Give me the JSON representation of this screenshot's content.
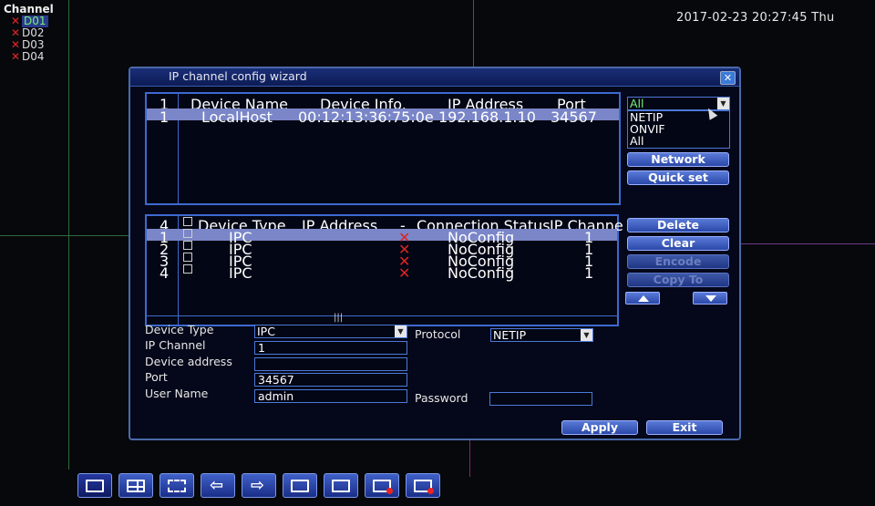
{
  "channel_list": {
    "title": "Channel",
    "items": [
      "D01",
      "D02",
      "D03",
      "D04"
    ],
    "selected": "D01"
  },
  "datetime": "2017-02-23 20:27:45 Thu",
  "dialog": {
    "title": "IP channel config wizard",
    "close_icon": "close-icon",
    "search_table": {
      "count": "1",
      "headers": [
        "Device Name",
        "Device Info.",
        "IP Address",
        "Port"
      ],
      "rows": [
        {
          "num": "1",
          "name": "LocalHost",
          "info": "00:12:13:36:75:0e",
          "ip": "192.168.1.10",
          "port": "34567"
        }
      ]
    },
    "protocol_filter": {
      "selected": "All",
      "options": [
        "NETIP",
        "ONVIF",
        "All"
      ]
    },
    "buttons_top": {
      "network": "Network",
      "quick_set": "Quick set"
    },
    "added_table": {
      "count": "4",
      "headers": [
        "Device Type",
        "IP Address",
        "-",
        "Connection Status",
        "IP Channe"
      ],
      "rows": [
        {
          "num": "1",
          "type": "IPC",
          "status": "NoConfig",
          "channel": "1"
        },
        {
          "num": "2",
          "type": "IPC",
          "status": "NoConfig",
          "channel": "1"
        },
        {
          "num": "3",
          "type": "IPC",
          "status": "NoConfig",
          "channel": "1"
        },
        {
          "num": "4",
          "type": "IPC",
          "status": "NoConfig",
          "channel": "1"
        }
      ],
      "scroll_thumb": "|||"
    },
    "buttons_side": {
      "delete": "Delete",
      "clear": "Clear",
      "encode": "Encode",
      "copy_to": "Copy To"
    },
    "form": {
      "device_type_label": "Device Type",
      "device_type": "IPC",
      "protocol_label": "Protocol",
      "protocol": "NETIP",
      "ip_channel_label": "IP Channel",
      "ip_channel": "1",
      "device_address_label": "Device address",
      "device_address": "",
      "port_label": "Port",
      "port": "34567",
      "user_name_label": "User Name",
      "user_name": "admin",
      "password_label": "Password",
      "password": ""
    },
    "footer": {
      "apply": "Apply",
      "exit": "Exit"
    }
  },
  "taskbar": [
    "single-view-icon",
    "quad-view-icon",
    "fullscreen-icon",
    "previous-icon",
    "next-icon",
    "record-icon",
    "playback-icon",
    "alarm-icon",
    "stop-icon"
  ]
}
